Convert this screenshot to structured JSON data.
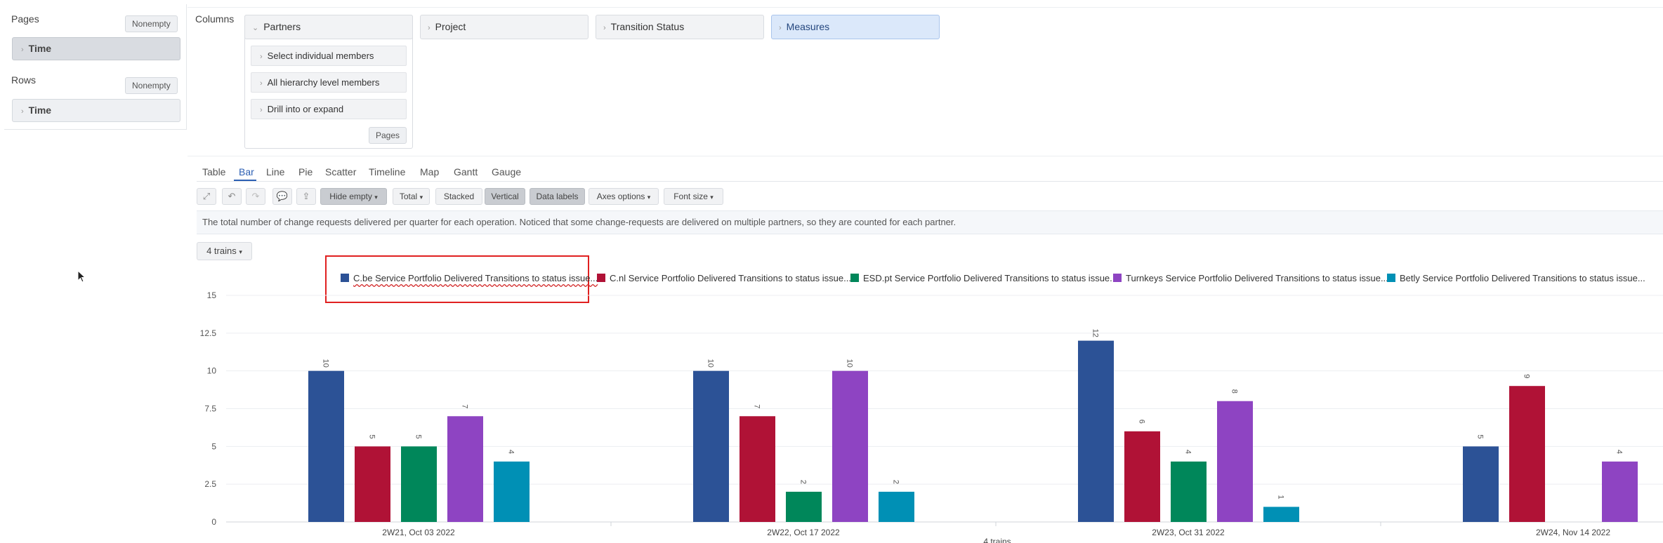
{
  "left": {
    "pages_label": "Pages",
    "pages_nonempty": "Nonempty",
    "pages_item": "Time",
    "rows_label": "Rows",
    "rows_nonempty": "Nonempty",
    "rows_item": "Time"
  },
  "columns": {
    "label": "Columns",
    "partners": "Partners",
    "project": "Project",
    "transition_status": "Transition Status",
    "measures": "Measures",
    "menu": [
      "Select individual members",
      "All hierarchy level members",
      "Drill into or expand"
    ],
    "pages_button": "Pages"
  },
  "tabs": [
    "Table",
    "Bar",
    "Line",
    "Pie",
    "Scatter",
    "Timeline",
    "Map",
    "Gantt",
    "Gauge"
  ],
  "active_tab": "Bar",
  "toolbar": {
    "hide_empty": "Hide empty",
    "total": "Total",
    "stacked": "Stacked",
    "vertical": "Vertical",
    "data_labels": "Data labels",
    "axes_options": "Axes options",
    "font_size": "Font size"
  },
  "description": "The total number of change requests delivered per quarter for each operation. Noticed that some change-requests are delivered on multiple partners, so they are counted for each partner.",
  "trains_dropdown": "4 trains",
  "colors": {
    "accent": "#2c5fb3",
    "highlight": "#e02020"
  },
  "chart_data": {
    "type": "bar",
    "categories": [
      "2W21, Oct 03 2022",
      "2W22, Oct 17 2022",
      "2W23, Oct 31 2022",
      "2W24, Nov 14 2022"
    ],
    "xlabel": "4 trains",
    "ylabel": "",
    "ylim": [
      0,
      15
    ],
    "yticks": [
      "0",
      "2.5",
      "5",
      "7.5",
      "10",
      "12.5",
      "15"
    ],
    "grid": true,
    "legend_position": "top",
    "series": [
      {
        "name": "C.be Service Portfolio Delivered Transitions to status issue...",
        "color": "#2c5296",
        "values": [
          10,
          10,
          12,
          5
        ]
      },
      {
        "name": "C.nl Service Portfolio Delivered Transitions to status issue...",
        "color": "#b01236",
        "values": [
          5,
          7,
          6,
          9
        ]
      },
      {
        "name": "ESD.pt Service Portfolio Delivered Transitions to status issue...",
        "color": "#00875a",
        "values": [
          5,
          2,
          4,
          null
        ]
      },
      {
        "name": "Turnkeys Service Portfolio Delivered Transitions to status issue...",
        "color": "#8e44c2",
        "values": [
          7,
          10,
          8,
          4
        ]
      },
      {
        "name": "Betly Service Portfolio Delivered Transitions to status issue...",
        "color": "#0090b5",
        "values": [
          4,
          2,
          1,
          null
        ]
      }
    ]
  }
}
